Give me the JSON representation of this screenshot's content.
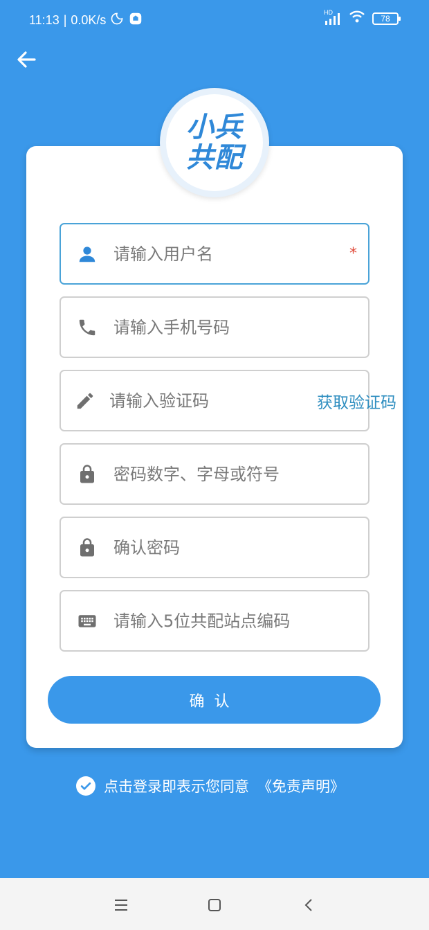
{
  "status": {
    "time": "11:13",
    "speed": "0.0K/s",
    "signal_label": "HD",
    "battery": "78"
  },
  "logo": {
    "line1": "小兵",
    "line2": "共配"
  },
  "form": {
    "username_placeholder": "请输入用户名",
    "required_mark": "*",
    "phone_placeholder": "请输入手机号码",
    "code_placeholder": "请输入验证码",
    "get_code_label": "获取验证码",
    "password_placeholder": "密码数字、字母或符号",
    "confirm_password_placeholder": "确认密码",
    "station_code_placeholder": "请输入5位共配站点编码",
    "submit_label": "确认"
  },
  "agreement": {
    "text": "点击登录即表示您同意",
    "link": "《免责声明》",
    "checked": true
  },
  "icons": {
    "back": "arrow-left-icon",
    "user": "person-icon",
    "phone": "phone-icon",
    "code": "pencil-icon",
    "password": "lock-icon",
    "confirm_password": "lock-icon",
    "station": "keyboard-icon"
  },
  "colors": {
    "primary": "#3a98ea",
    "icon_user": "#2f88d8",
    "icon_gray": "#6f6f6f",
    "link": "#2f8ec0",
    "required": "#e04a3a"
  }
}
